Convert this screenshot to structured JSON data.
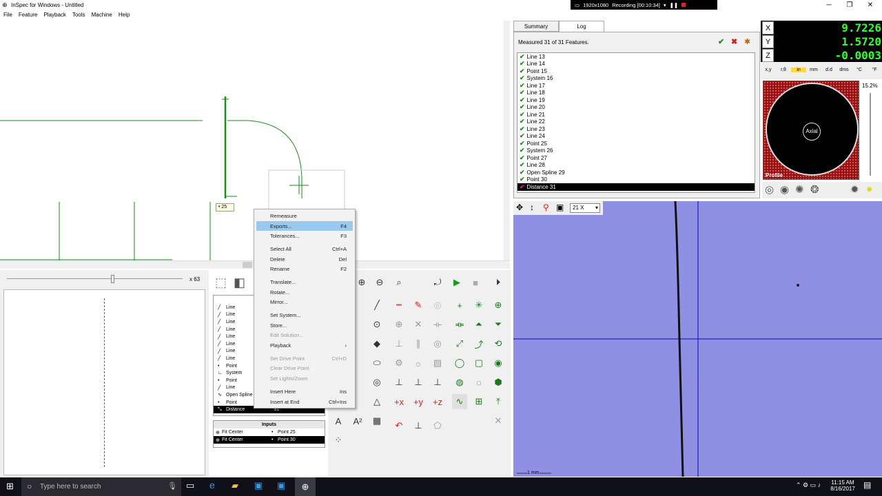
{
  "window": {
    "title": "InSpec for Windows - Untitled",
    "minimize": "─",
    "maximize": "❐",
    "close": "✕"
  },
  "menu": [
    "File",
    "Feature",
    "Playback",
    "Tools",
    "Machine",
    "Help"
  ],
  "recorder": {
    "resolution": "1920x1080",
    "status": "Recording [00:10:34]"
  },
  "canvas": {
    "feature_tag": "25"
  },
  "zoom": {
    "label": "x 63"
  },
  "feature_list": [
    {
      "name": "Line",
      "icon": "line"
    },
    {
      "name": "Line",
      "icon": "line"
    },
    {
      "name": "Line",
      "icon": "line"
    },
    {
      "name": "Line",
      "icon": "line"
    },
    {
      "name": "Line",
      "icon": "line"
    },
    {
      "name": "Line",
      "icon": "line"
    },
    {
      "name": "Line",
      "icon": "line"
    },
    {
      "name": "Line",
      "icon": "line"
    },
    {
      "name": "Point",
      "icon": "point"
    },
    {
      "name": "System",
      "icon": "system"
    },
    {
      "name": "Point",
      "icon": "point"
    },
    {
      "name": "Line",
      "icon": "line"
    },
    {
      "name": "Open Spline",
      "icon": "spline"
    },
    {
      "name": "Point",
      "icon": "point"
    },
    {
      "name": "Distance",
      "icon": "distance",
      "num": "31",
      "selected": true
    }
  ],
  "inputs": {
    "header": "Inputs",
    "rows": [
      {
        "type": "Fit Center",
        "point": "Point 25",
        "selected": false
      },
      {
        "type": "Fit Center",
        "point": "Point 30",
        "selected": true
      }
    ]
  },
  "context_menu": [
    {
      "label": "Remeasure",
      "key": ""
    },
    {
      "label": "Exports...",
      "key": "F4",
      "highlight": true
    },
    {
      "label": "Tolerances...",
      "key": "F3"
    },
    {
      "sep": true
    },
    {
      "label": "Select All",
      "key": "Ctrl+A"
    },
    {
      "label": "Delete",
      "key": "Del"
    },
    {
      "label": "Rename",
      "key": "F2"
    },
    {
      "sep": true
    },
    {
      "label": "Translate...",
      "key": ""
    },
    {
      "label": "Rotate...",
      "key": ""
    },
    {
      "label": "Mirror...",
      "key": ""
    },
    {
      "sep": true
    },
    {
      "label": "Set System...",
      "key": ""
    },
    {
      "label": "Store...",
      "key": ""
    },
    {
      "label": "Edit Solution...",
      "key": "",
      "disabled": true
    },
    {
      "label": "Playback",
      "key": "›"
    },
    {
      "sep": true
    },
    {
      "label": "Set Drive Point",
      "key": "Ctrl+D",
      "disabled": true
    },
    {
      "label": "Clear Drive Point",
      "key": "",
      "disabled": true
    },
    {
      "label": "Set Lights/Zoom",
      "key": "",
      "disabled": true
    },
    {
      "sep": true
    },
    {
      "label": "Insert Here",
      "key": "Ins"
    },
    {
      "label": "Insert at End",
      "key": "Ctrl+Ins"
    }
  ],
  "tabs": [
    {
      "label": "Summary"
    },
    {
      "label": "Log"
    }
  ],
  "summary": {
    "status": "Measured 31 of 31 Features."
  },
  "log": [
    "Line 13",
    "Line 14",
    "Point 15",
    "System 16",
    "Line 17",
    "Line 18",
    "Line 19",
    "Line 20",
    "Line 21",
    "Line 22",
    "Line 23",
    "Line 24",
    "Point 25",
    "System 26",
    "Point 27",
    "Line 28",
    "Open Spline 29",
    "Point 30",
    "Distance 31"
  ],
  "dro": {
    "x_label": "X",
    "y_label": "Y",
    "z_label": "Z",
    "x": "9.7226",
    "y": "1.5720",
    "z": "-0.0003"
  },
  "units": [
    "x,y",
    "r,θ",
    "in",
    "mm",
    "d.d",
    "dms",
    "°C",
    "°F"
  ],
  "lights": {
    "center": "Axial",
    "label": "Profile",
    "percent": "15.2%"
  },
  "camera": {
    "zoom": "21 X",
    "scale": "1 mm"
  },
  "taskbar": {
    "search": "Type here to search",
    "time": "11:15 AM",
    "date": "8/16/2017"
  }
}
